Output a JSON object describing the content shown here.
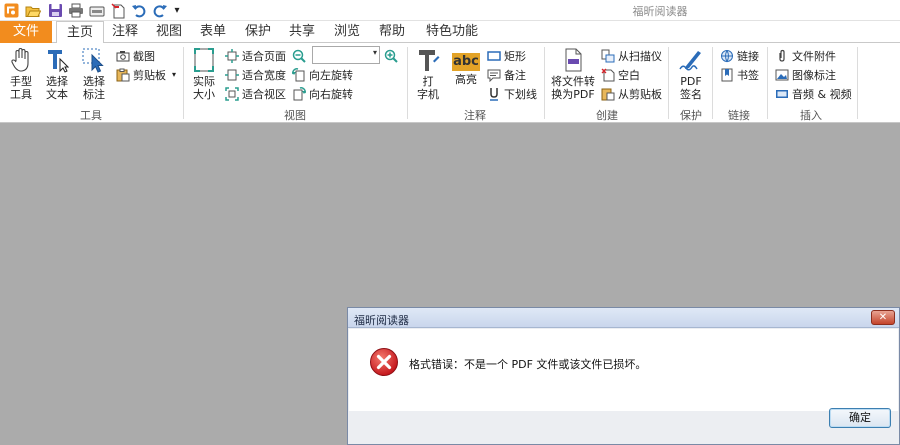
{
  "app": {
    "title": "福昕阅读器"
  },
  "quick_access": {
    "icons": [
      "app-logo-icon",
      "open-folder-icon",
      "save-icon",
      "print-icon",
      "scan-icon",
      "new-icon",
      "undo-icon",
      "redo-icon",
      "customize-icon"
    ],
    "customize_glyph": "▾"
  },
  "tabs": {
    "file": "文件",
    "home": "主页",
    "comment": "注释",
    "view": "视图",
    "form": "表单",
    "protect": "保护",
    "share": "共享",
    "browse": "浏览",
    "help": "帮助",
    "features": "特色功能"
  },
  "ribbon": {
    "tools": {
      "label": "工具",
      "hand_line1": "手型",
      "hand_line2": "工具",
      "select_text_line1": "选择",
      "select_text_line2": "文本",
      "select_annot_line1": "选择",
      "select_annot_line2": "标注",
      "snapshot": "截图",
      "clipboard": "剪贴板",
      "clipboard_arrow": "▾"
    },
    "view": {
      "label": "视图",
      "actual_size_line1": "实际",
      "actual_size_line2": "大小",
      "fit_page": "适合页面",
      "fit_width": "适合宽度",
      "fit_visible": "适合视区",
      "zoom_value": "",
      "zoom_arrow": "▾",
      "rotate_left": "向左旋转",
      "rotate_right": "向右旋转"
    },
    "comment": {
      "label": "注释",
      "typewriter_line1": "打",
      "typewriter_line2": "字机",
      "highlight": "高亮",
      "highlight_icon_text": "abc",
      "rectangle": "矩形",
      "note": "备注",
      "underline": "下划线"
    },
    "create": {
      "label": "创建",
      "convert_line1": "将文件转",
      "convert_line2": "换为PDF",
      "from_scanner": "从扫描仪",
      "blank": "空白",
      "from_clipboard": "从剪贴板"
    },
    "protect": {
      "label": "保护",
      "pdf_sign_line1": "PDF",
      "pdf_sign_line2": "签名"
    },
    "links": {
      "label": "链接",
      "link": "链接",
      "bookmark": "书签"
    },
    "insert": {
      "label": "插入",
      "file_attachment": "文件附件",
      "image_annotation": "图像标注",
      "audio_video": "音频 & 视频"
    }
  },
  "dialog": {
    "title": "福昕阅读器",
    "close_glyph": "✕",
    "message": "格式错误：不是一个 PDF 文件或该文件已损坏。",
    "ok_label": "确定"
  },
  "colors": {
    "file_tab": "#f28c1e",
    "workspace": "#ababab",
    "error_red": "#d8232a",
    "accent_blue": "#2b6cb8"
  }
}
